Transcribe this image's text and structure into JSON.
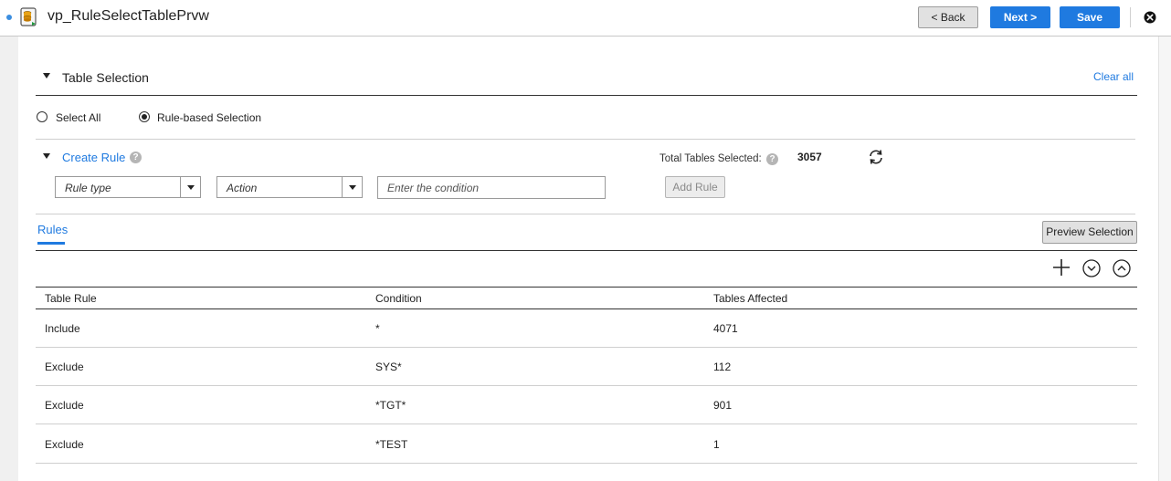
{
  "header": {
    "title": "vp_RuleSelectTablePrvw",
    "back_label": "< Back",
    "next_label": "Next >",
    "save_label": "Save"
  },
  "table_selection": {
    "title": "Table Selection",
    "clear_all": "Clear all",
    "select_all_label": "Select All",
    "rule_based_label": "Rule-based Selection",
    "selected_mode": "rule-based"
  },
  "create_rule": {
    "title": "Create Rule",
    "rule_type_placeholder": "Rule type",
    "action_placeholder": "Action",
    "condition_placeholder": "Enter the condition",
    "add_rule_label": "Add Rule",
    "total_label": "Total Tables Selected:",
    "total_value": "3057"
  },
  "rules": {
    "tab_label": "Rules",
    "preview_label": "Preview Selection",
    "columns": [
      "Table Rule",
      "Condition",
      "Tables Affected"
    ],
    "rows": [
      {
        "rule": "Include",
        "condition": "*",
        "affected": "4071"
      },
      {
        "rule": "Exclude",
        "condition": "SYS*",
        "affected": "112"
      },
      {
        "rule": "Exclude",
        "condition": "*TGT*",
        "affected": "901"
      },
      {
        "rule": "Exclude",
        "condition": "*TEST",
        "affected": "1"
      }
    ]
  },
  "colors": {
    "accent": "#1f7ae0",
    "header_bg": "#ffffff",
    "page_bg": "#f0f0f0"
  },
  "icons": [
    "app-icon",
    "close-icon",
    "help-icon",
    "refresh-icon",
    "add-icon",
    "move-down-icon",
    "move-up-icon"
  ]
}
